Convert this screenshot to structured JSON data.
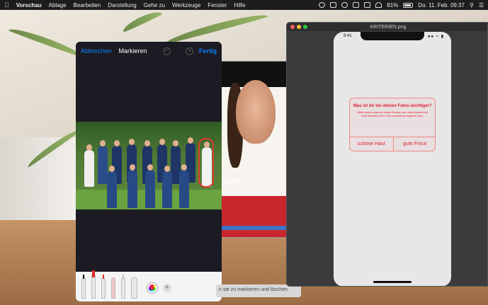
{
  "menubar": {
    "app_name": "Vorschau",
    "menus": [
      "Ablage",
      "Bearbeiten",
      "Darstellung",
      "Gehe zu",
      "Werkzeuge",
      "Fenster",
      "Hilfe"
    ],
    "battery": "81%",
    "datetime": "Do. 11. Feb.  09:37"
  },
  "markup": {
    "cancel_label": "Abbrechen",
    "title": "Markieren",
    "done_label": "Fertig",
    "accent_color": "#0a84ff"
  },
  "photo_back": {
    "caption": "LOVE"
  },
  "tooltip": {
    "text": "n sie zu markieren und löschen."
  },
  "preview": {
    "window_title": "KRITERIEN.png",
    "phone_time": "9:41",
    "dialog": {
      "title": "Was ist dir bei deinen Fotos wichtiger?",
      "message": "Wähle jeweils zwischen beiden Kriterien aus, damit Assortier auf deine Wünsche beim Fotos Aussortieren eingehen kann.",
      "option_left": "schöne Haut",
      "option_right": "gute Frisur",
      "accent_color": "#dd2233"
    }
  }
}
